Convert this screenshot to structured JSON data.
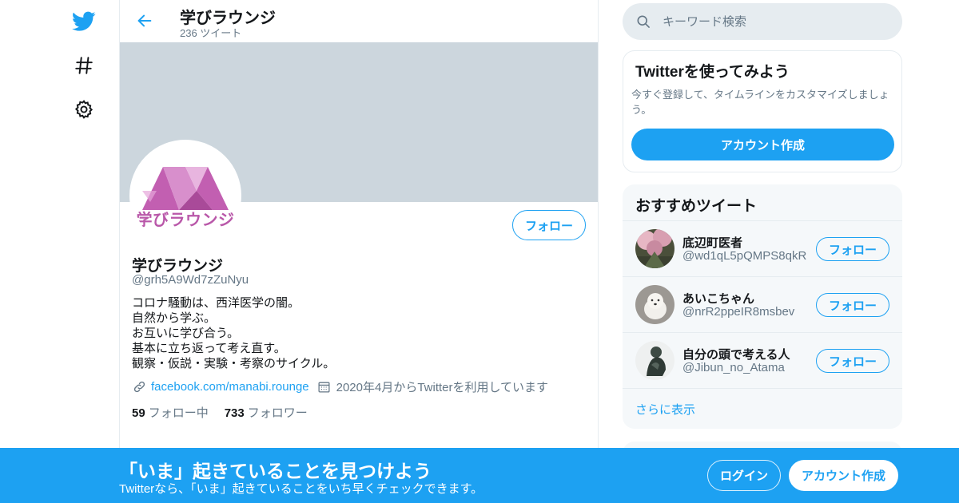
{
  "colors": {
    "accent": "#1da1f2",
    "banner": "#ccd6dd",
    "muted": "#657786",
    "logo_pink": "#c25fb1"
  },
  "nav": {
    "icons": [
      "twitter-logo-icon",
      "hashtag-icon",
      "settings-gear-icon"
    ]
  },
  "header": {
    "title": "学びラウンジ",
    "tweet_count": "236 ツイート"
  },
  "profile": {
    "avatar_text": "学びラウンジ",
    "follow_label": "フォロー",
    "name": "学びラウンジ",
    "handle": "@grh5A9Wd7zZuNyu",
    "bio": [
      "コロナ騒動は、西洋医学の闇。",
      "自然から学ぶ。",
      "お互いに学び合う。",
      "基本に立ち返って考え直す。",
      "観察・仮説・実験・考察のサイクル。"
    ],
    "link": "facebook.com/manabi.rounge",
    "joined": "2020年4月からTwitterを利用しています",
    "following_count": "59",
    "following_label": "フォロー中",
    "followers_count": "733",
    "followers_label": "フォロワー"
  },
  "search": {
    "placeholder": "キーワード検索"
  },
  "signup_card": {
    "title": "Twitterを使ってみよう",
    "body": "今すぐ登録して、タイムラインをカスタマイズしましょう。",
    "button": "アカウント作成"
  },
  "recommend": {
    "title": "おすすめツイート",
    "items": [
      {
        "name": "底辺町医者",
        "handle": "@wd1qL5pQMPS8qkR",
        "follow": "フォロー"
      },
      {
        "name": "あいこちゃん",
        "handle": "@nrR2ppeIR8msbev",
        "follow": "フォロー"
      },
      {
        "name": "自分の頭で考える人",
        "handle": "@Jibun_no_Atama",
        "follow": "フォロー"
      }
    ],
    "more": "さらに表示"
  },
  "bottom_bar": {
    "headline": "「いま」起きていることを見つけよう",
    "sub": "Twitterなら、「いま」起きていることをいち早くチェックできます。",
    "login": "ログイン",
    "signup": "アカウント作成"
  }
}
